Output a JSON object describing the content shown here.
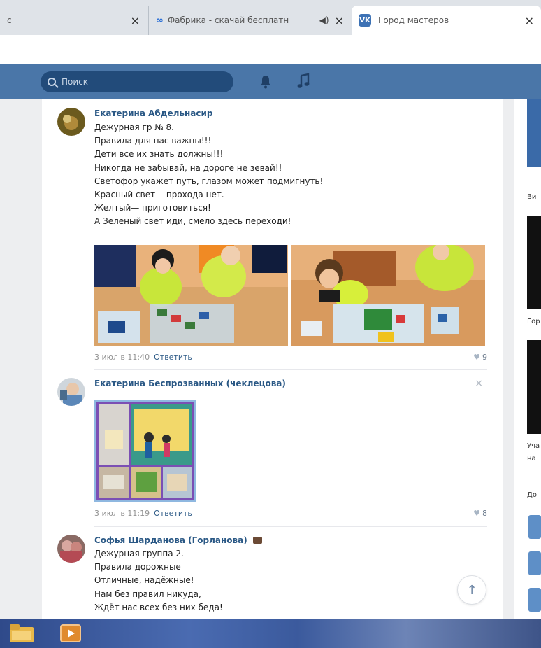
{
  "browser": {
    "tabs": [
      {
        "title": "с",
        "close": "×"
      },
      {
        "title": "Фабрика - скачай бесплатн",
        "favicon": "∞",
        "close": "×"
      },
      {
        "title": "Город мастеров",
        "favicon": "VK",
        "close": "×"
      }
    ]
  },
  "header": {
    "search_placeholder": "Поиск",
    "bg_color": "#4a76a8"
  },
  "comments": [
    {
      "author": "Екатерина Абдельнасир",
      "lines": [
        "Дежурная гр № 8.",
        "Правила для нас важны!!!",
        "Дети все их знать должны!!!",
        "Никогда не забывай, на дороге не зевай!!",
        "Светофор укажет путь, глазом может подмигнуть!",
        "Красный свет— прохода нет.",
        "Желтый— приготовиться!",
        "А Зеленый свет иди, смело здесь переходи!"
      ],
      "date": "3 июл в 11:40",
      "reply": "Ответить",
      "likes": "9"
    },
    {
      "author": "Екатерина Беспрозванных (чеклецова)",
      "date": "3 июл в 11:19",
      "reply": "Ответить",
      "likes": "8",
      "close": "×"
    },
    {
      "author": "Софья Шарданова (Горланова)",
      "lines": [
        "Дежурная группа 2.",
        "Правила дорожные",
        "Отличные, надёжные!",
        "Нам без правил никуда,",
        "Ждёт нас всех без них беда!"
      ]
    }
  ],
  "right_column": {
    "texts": [
      "Ви",
      "Гор",
      "Уча",
      "на",
      "До"
    ]
  },
  "scroll_up": "↑"
}
